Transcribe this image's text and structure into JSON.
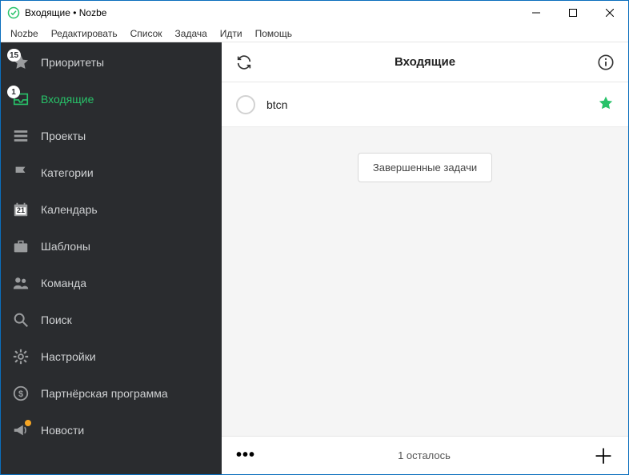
{
  "window": {
    "title": "Входящие • Nozbe"
  },
  "menu": {
    "items": [
      "Nozbe",
      "Редактировать",
      "Список",
      "Задача",
      "Идти",
      "Помощь"
    ]
  },
  "sidebar": {
    "items": [
      {
        "id": "priorities",
        "label": "Приоритеты",
        "badge": "15"
      },
      {
        "id": "inbox",
        "label": "Входящие",
        "badge": "1",
        "active": true
      },
      {
        "id": "projects",
        "label": "Проекты"
      },
      {
        "id": "categories",
        "label": "Категории"
      },
      {
        "id": "calendar",
        "label": "Календарь",
        "calnum": "21"
      },
      {
        "id": "templates",
        "label": "Шаблоны"
      },
      {
        "id": "team",
        "label": "Команда"
      },
      {
        "id": "search",
        "label": "Поиск"
      },
      {
        "id": "settings",
        "label": "Настройки"
      },
      {
        "id": "affiliate",
        "label": "Партнёрская программа"
      },
      {
        "id": "news",
        "label": "Новости",
        "dot": true
      }
    ]
  },
  "topbar": {
    "title": "Входящие"
  },
  "tasks": [
    {
      "title": "btcn",
      "starred": true
    }
  ],
  "done_button": "Завершенные задачи",
  "bottom": {
    "remaining": "1 осталось"
  }
}
